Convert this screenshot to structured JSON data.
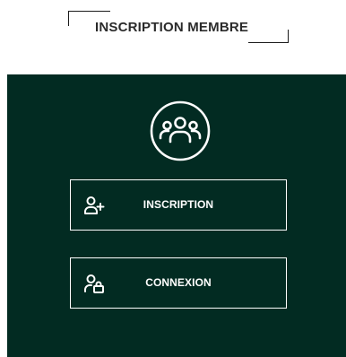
{
  "header": {
    "title": "INSCRIPTION MEMBRE"
  },
  "panel": {
    "background_color": "#022b22",
    "hero_icon": "group-users-icon",
    "buttons": [
      {
        "label": "INSCRIPTION",
        "icon": "user-plus-icon"
      },
      {
        "label": "CONNEXION",
        "icon": "user-lock-icon"
      }
    ]
  }
}
